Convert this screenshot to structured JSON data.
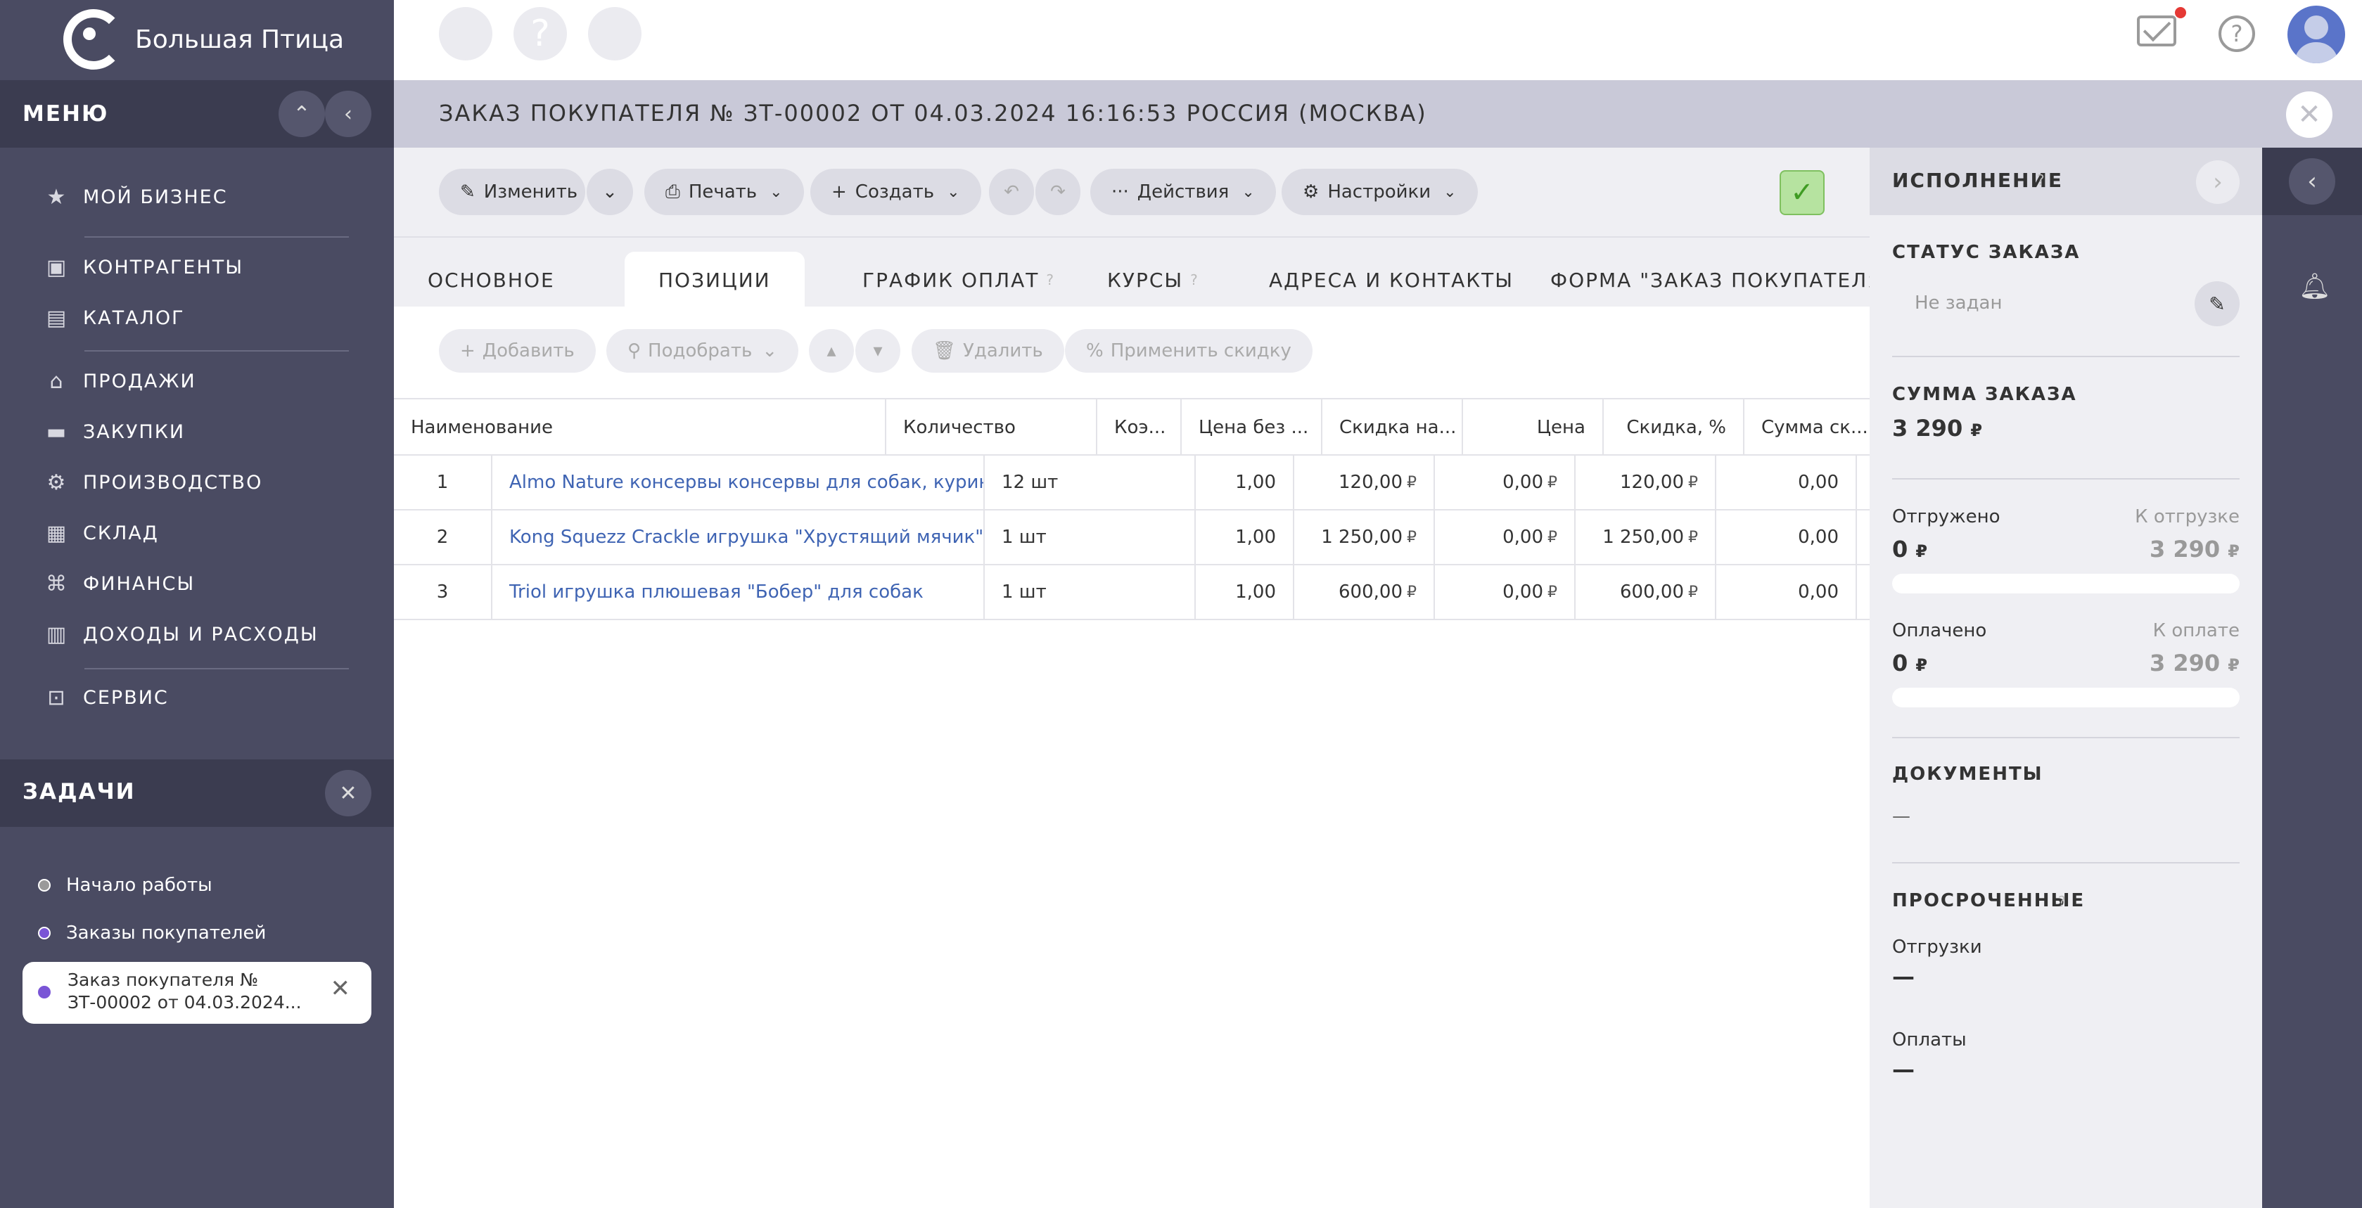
{
  "app": {
    "logo_text": "Большая Птица"
  },
  "menu": {
    "title": "МЕНЮ",
    "items": [
      {
        "label": "МОЙ БИЗНЕС",
        "icon": "star-icon"
      },
      {
        "label": "КОНТРАГЕНТЫ",
        "icon": "briefcase-icon"
      },
      {
        "label": "КАТАЛОГ",
        "icon": "book-icon"
      },
      {
        "label": "ПРОДАЖИ",
        "icon": "basket-icon"
      },
      {
        "label": "ЗАКУПКИ",
        "icon": "truck-icon"
      },
      {
        "label": "ПРОИЗВОДСТВО",
        "icon": "factory-icon"
      },
      {
        "label": "СКЛАД",
        "icon": "warehouse-icon"
      },
      {
        "label": "ФИНАНСЫ",
        "icon": "bank-icon"
      },
      {
        "label": "ДОХОДЫ И РАСХОДЫ",
        "icon": "wallet-icon"
      },
      {
        "label": "СЕРВИС",
        "icon": "service-icon"
      }
    ]
  },
  "tasks": {
    "title": "ЗАДАЧИ",
    "items": [
      {
        "label": "Начало работы",
        "color": "#9a9a9a"
      },
      {
        "label": "Заказы покупателей",
        "color": "#7a55d6"
      }
    ],
    "active_line1": "Заказ покупателя №",
    "active_line2": "ЗТ-00002 от 04.03.2024...",
    "active_color": "#7a55d6"
  },
  "header": {
    "order_title": "ЗАКАЗ ПОКУПАТЕЛЯ № ЗТ-00002 ОТ 04.03.2024 16:16:53 РОССИЯ (МОСКВА)"
  },
  "toolbar": {
    "edit": "Изменить",
    "print": "Печать",
    "create": "Создать",
    "actions": "Действия",
    "settings": "Настройки"
  },
  "tabs": [
    "ОСНОВНОЕ",
    "ПОЗИЦИИ",
    "ГРАФИК ОПЛАТ",
    "КУРСЫ",
    "АДРЕСА И КОНТАКТЫ",
    "ФОРМА \"ЗАКАЗ ПОКУПАТЕЛЯ\""
  ],
  "subtoolbar": {
    "add": "Добавить",
    "pick": "Подобрать",
    "delete": "Удалить",
    "discount": "Применить скидку"
  },
  "table": {
    "columns": [
      "Наименование",
      "Количество",
      "Коэ...",
      "Цена без ...",
      "Скидка на...",
      "Цена",
      "Скидка, %",
      "Сумма ск..."
    ],
    "currency": "₽",
    "rows": [
      {
        "n": "1",
        "name": "Almo Nature консервы консервы для собак, курины...",
        "qty": "12 шт",
        "coef": "1,00",
        "price_wo": "120,00",
        "disc_on": "0,00",
        "price": "120,00",
        "disc_pct": "0,00"
      },
      {
        "n": "2",
        "name": "Kong Squezz Crackle игрушка \"Хрустящий мячик\" дл...",
        "qty": "1 шт",
        "coef": "1,00",
        "price_wo": "1 250,00",
        "disc_on": "0,00",
        "price": "1 250,00",
        "disc_pct": "0,00"
      },
      {
        "n": "3",
        "name": "Triol игрушка плюшевая \"Бобер\" для собак",
        "qty": "1 шт",
        "coef": "1,00",
        "price_wo": "600,00",
        "disc_on": "0,00",
        "price": "600,00",
        "disc_pct": "0,00"
      }
    ]
  },
  "execution": {
    "title": "ИСПОЛНЕНИЕ",
    "status_title": "СТАТУС ЗАКАЗА",
    "status_value": "Не задан",
    "sum_title": "СУММА ЗАКАЗА",
    "sum_value": "3 290",
    "shipped_label": "Отгружено",
    "shipped_value": "0",
    "to_ship_label": "К отгрузке",
    "to_ship_value": "3 290",
    "paid_label": "Оплачено",
    "paid_value": "0",
    "to_pay_label": "К оплате",
    "to_pay_value": "3 290",
    "docs_title": "ДОКУМЕНТЫ",
    "docs_value": "—",
    "overdue_title": "ПРОСРОЧЕННЫЕ",
    "shipments_label": "Отгрузки",
    "shipments_value": "—",
    "payments_label": "Оплаты",
    "payments_value": "—",
    "currency": "₽",
    "shipped_progress": 0,
    "paid_progress": 0
  }
}
